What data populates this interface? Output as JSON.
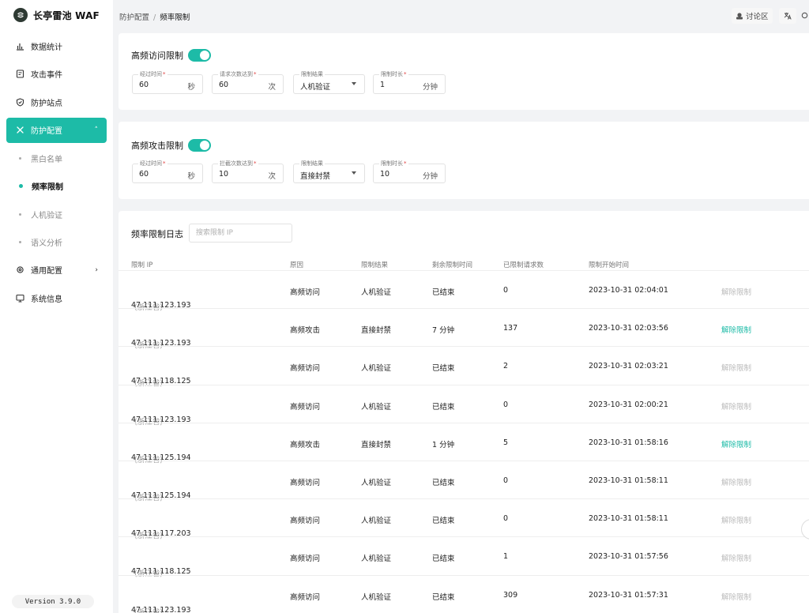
{
  "brand": {
    "name": "长亭雷池 WAF"
  },
  "sidebar": {
    "items": [
      {
        "label": "数据统计",
        "icon": "bar-chart-icon"
      },
      {
        "label": "攻击事件",
        "icon": "event-icon"
      },
      {
        "label": "防护站点",
        "icon": "shield-icon"
      },
      {
        "label": "防护配置",
        "icon": "tools-icon",
        "chevron": "˄"
      },
      {
        "label": "通用配置",
        "icon": "gear-icon",
        "chevron": "›"
      },
      {
        "label": "系统信息",
        "icon": "monitor-icon"
      }
    ],
    "sub_items": [
      {
        "label": "黑白名单"
      },
      {
        "label": "频率限制"
      },
      {
        "label": "人机验证"
      },
      {
        "label": "语义分析"
      }
    ],
    "version": "Version 3.9.0"
  },
  "breadcrumb": {
    "parent": "防护配置",
    "separator": "/",
    "current": "频率限制"
  },
  "header": {
    "forum_label": "讨论区"
  },
  "high_freq_access": {
    "title": "高频访问限制",
    "time_label": "经过时间",
    "time_value": "60",
    "time_unit": "秒",
    "count_label": "请求次数达到",
    "count_value": "60",
    "count_unit": "次",
    "result_label": "限制结果",
    "result_value": "人机验证",
    "duration_label": "限制时长",
    "duration_value": "1",
    "duration_unit": "分钟"
  },
  "high_freq_attack": {
    "title": "高频攻击限制",
    "time_label": "经过时间",
    "time_value": "60",
    "time_unit": "秒",
    "count_label": "拦截次数达到",
    "count_value": "10",
    "count_unit": "次",
    "result_label": "限制结果",
    "result_value": "直接封禁",
    "duration_label": "限制时长",
    "duration_value": "10",
    "duration_unit": "分钟"
  },
  "log": {
    "title": "频率限制日志",
    "search_placeholder": "搜索限制 IP",
    "columns": [
      "限制 IP",
      "原因",
      "限制结果",
      "剩余限制时间",
      "已限制请求数",
      "限制开始时间"
    ],
    "rows": [
      {
        "ip": "47.111.123.193",
        "province": "(浙江省)",
        "reason": "高频访问",
        "result": "人机验证",
        "remaining": "已结束",
        "count": "0",
        "start": "2023-10-31 02:04:01",
        "action": "解除限制",
        "active": false
      },
      {
        "ip": "47.111.123.193",
        "province": "(浙江省)",
        "reason": "高频攻击",
        "result": "直接封禁",
        "remaining": "7 分钟",
        "count": "137",
        "start": "2023-10-31 02:03:56",
        "action": "解除限制",
        "active": true
      },
      {
        "ip": "47.111.118.125",
        "province": "(浙江省)",
        "reason": "高频访问",
        "result": "人机验证",
        "remaining": "已结束",
        "count": "2",
        "start": "2023-10-31 02:03:21",
        "action": "解除限制",
        "active": false
      },
      {
        "ip": "47.111.123.193",
        "province": "(浙江省)",
        "reason": "高频访问",
        "result": "人机验证",
        "remaining": "已结束",
        "count": "0",
        "start": "2023-10-31 02:00:21",
        "action": "解除限制",
        "active": false
      },
      {
        "ip": "47.111.125.194",
        "province": "(浙江省)",
        "reason": "高频攻击",
        "result": "直接封禁",
        "remaining": "1 分钟",
        "count": "5",
        "start": "2023-10-31 01:58:16",
        "action": "解除限制",
        "active": true
      },
      {
        "ip": "47.111.125.194",
        "province": "(浙江省)",
        "reason": "高频访问",
        "result": "人机验证",
        "remaining": "已结束",
        "count": "0",
        "start": "2023-10-31 01:58:11",
        "action": "解除限制",
        "active": false
      },
      {
        "ip": "47.111.117.203",
        "province": "(浙江省)",
        "reason": "高频访问",
        "result": "人机验证",
        "remaining": "已结束",
        "count": "0",
        "start": "2023-10-31 01:58:11",
        "action": "解除限制",
        "active": false
      },
      {
        "ip": "47.111.118.125",
        "province": "(浙江省)",
        "reason": "高频访问",
        "result": "人机验证",
        "remaining": "已结束",
        "count": "1",
        "start": "2023-10-31 01:57:56",
        "action": "解除限制",
        "active": false
      },
      {
        "ip": "47.111.123.193",
        "province": "(浙江省)",
        "reason": "高频访问",
        "result": "人机验证",
        "remaining": "已结束",
        "count": "309",
        "start": "2023-10-31 01:57:31",
        "action": "解除限制",
        "active": false
      }
    ]
  },
  "colors": {
    "accent": "#1dbba7",
    "background": "#f2f3f5",
    "disabled_action": "#bbbbbb"
  }
}
